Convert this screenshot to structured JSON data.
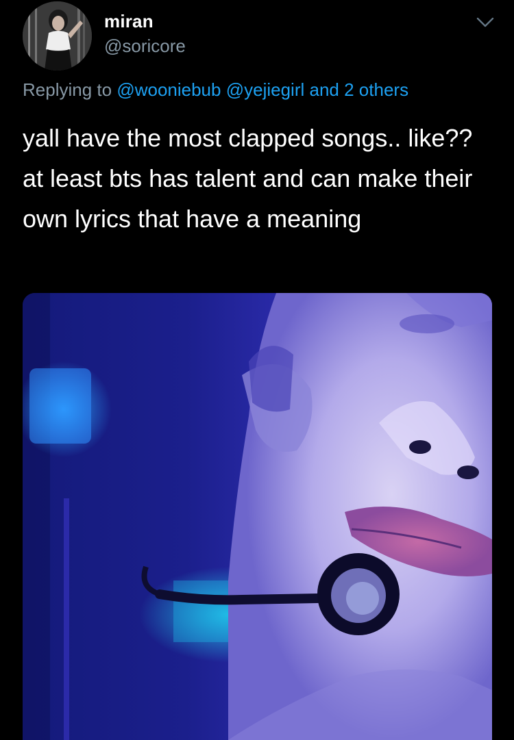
{
  "user": {
    "display_name": "miran",
    "handle": "@soricore"
  },
  "reply": {
    "prefix": "Replying to",
    "mentions": [
      "@wooniebub",
      "@yejiegirl"
    ],
    "connector": "and",
    "others": "2 others"
  },
  "tweet": {
    "text": "yall have the most clapped songs.. like?? at least bts has talent and can make their own lyrics that have a meaning"
  },
  "icons": {
    "menu": "chevron-down-icon"
  },
  "colors": {
    "background": "#000000",
    "secondary_text": "#8899a6",
    "link": "#1da1f2"
  }
}
